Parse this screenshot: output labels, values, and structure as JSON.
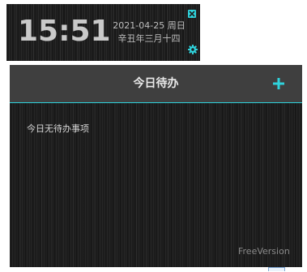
{
  "clock": {
    "time": "15:51",
    "date": "2021-04-25 周日",
    "lunar": "辛丑年三月十四",
    "close_icon": "close-icon",
    "settings_icon": "gear-icon"
  },
  "todo": {
    "title": "今日待办",
    "add_icon": "plus-icon",
    "empty_message": "今日无待办事项",
    "footer_label": "FreeVersion"
  },
  "colors": {
    "accent": "#2fd3dc",
    "header_bg": "#3f3f3f",
    "panel_bg": "#1c1c1c"
  }
}
